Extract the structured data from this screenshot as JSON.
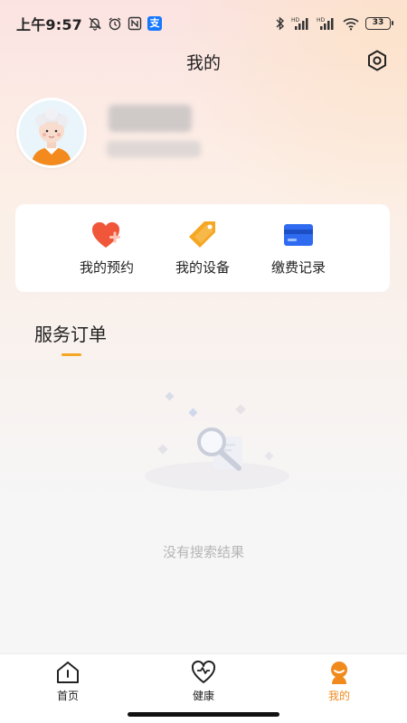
{
  "status_bar": {
    "time": "上午9:57",
    "battery": "33"
  },
  "header": {
    "title": "我的"
  },
  "profile": {
    "name": "",
    "subtitle": ""
  },
  "quick_actions": [
    {
      "label": "我的预约",
      "icon": "heart-plus-icon",
      "color": "#f0573a"
    },
    {
      "label": "我的设备",
      "icon": "tag-icon",
      "color": "#f5a623"
    },
    {
      "label": "缴费记录",
      "icon": "card-icon",
      "color": "#2f6bf0"
    }
  ],
  "orders": {
    "section_title": "服务订单",
    "empty_text": "没有搜索结果"
  },
  "tabs": [
    {
      "label": "首页",
      "icon": "home-icon",
      "active": false
    },
    {
      "label": "健康",
      "icon": "heart-icon",
      "active": false
    },
    {
      "label": "我的",
      "icon": "profile-icon",
      "active": true
    }
  ],
  "colors": {
    "accent": "#f08a1c",
    "underline": "#f5a623",
    "background": "#f6f6f7"
  }
}
